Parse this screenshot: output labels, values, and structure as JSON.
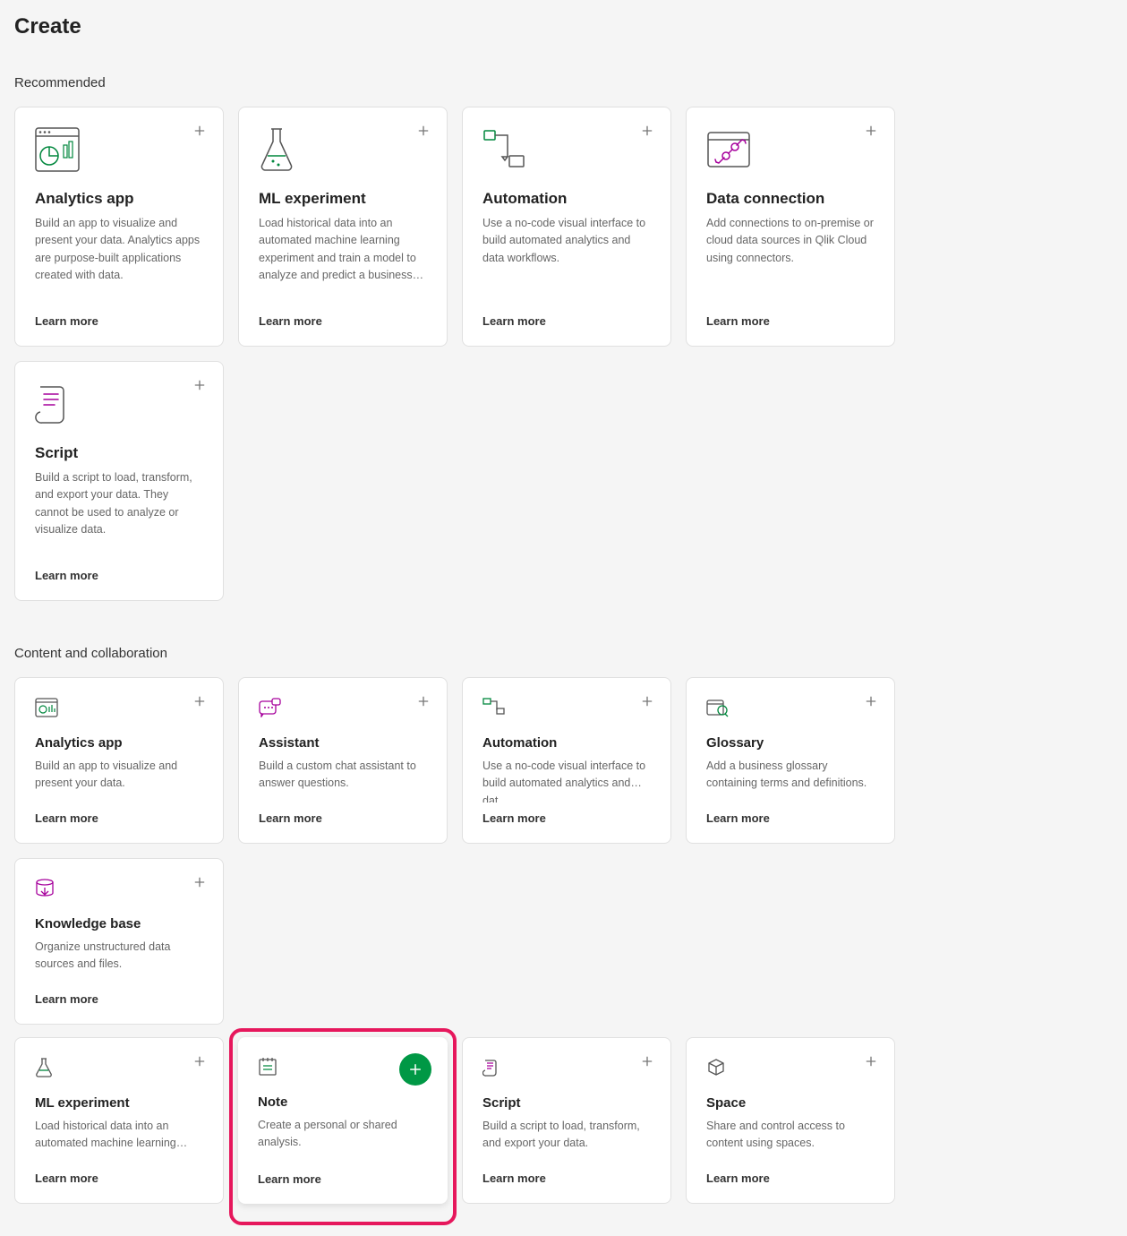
{
  "page_title": "Create",
  "sections": {
    "recommended": {
      "title": "Recommended",
      "cards": [
        {
          "title": "Analytics app",
          "desc": "Build an app to visualize and present your data. Analytics apps are purpose-built applications created with data.",
          "learn": "Learn more",
          "icon": "analytics-app-icon"
        },
        {
          "title": "ML experiment",
          "desc": "Load historical data into an automated machine learning experiment and train a model to analyze and predict a business…",
          "learn": "Learn more",
          "icon": "flask-icon"
        },
        {
          "title": "Automation",
          "desc": "Use a no-code visual interface to build automated analytics and data workflows.",
          "learn": "Learn more",
          "icon": "automation-icon"
        },
        {
          "title": "Data connection",
          "desc": "Add connections to on-premise or cloud data sources in Qlik Cloud using connectors.",
          "learn": "Learn more",
          "icon": "data-connection-icon"
        },
        {
          "title": "Script",
          "desc": "Build a script to load, transform, and export your data. They cannot be used to analyze or visualize data.",
          "learn": "Learn more",
          "icon": "script-icon"
        }
      ]
    },
    "content": {
      "title": "Content and collaboration",
      "cards": [
        {
          "title": "Analytics app",
          "desc": "Build an app to visualize and present your data.",
          "learn": "Learn more",
          "icon": "analytics-app-small-icon"
        },
        {
          "title": "Assistant",
          "desc": "Build a custom chat assistant to answer questions.",
          "learn": "Learn more",
          "icon": "assistant-icon"
        },
        {
          "title": "Automation",
          "desc": "Use a no-code visual interface to build automated analytics and dat…",
          "learn": "Learn more",
          "icon": "automation-small-icon"
        },
        {
          "title": "Glossary",
          "desc": "Add a business glossary containing terms and definitions.",
          "learn": "Learn more",
          "icon": "glossary-icon"
        },
        {
          "title": "Knowledge base",
          "desc": "Organize unstructured data sources and files.",
          "learn": "Learn more",
          "icon": "knowledge-base-icon"
        },
        {
          "title": "ML experiment",
          "desc": "Load historical data into an automated machine learning…",
          "learn": "Learn more",
          "icon": "flask-small-icon"
        },
        {
          "title": "Note",
          "desc": "Create a personal or shared analysis.",
          "learn": "Learn more",
          "icon": "note-icon",
          "highlight": true
        },
        {
          "title": "Script",
          "desc": "Build a script to load, transform, and export your data.",
          "learn": "Learn more",
          "icon": "script-small-icon"
        },
        {
          "title": "Space",
          "desc": "Share and control access to content using spaces.",
          "learn": "Learn more",
          "icon": "space-icon"
        }
      ]
    }
  }
}
